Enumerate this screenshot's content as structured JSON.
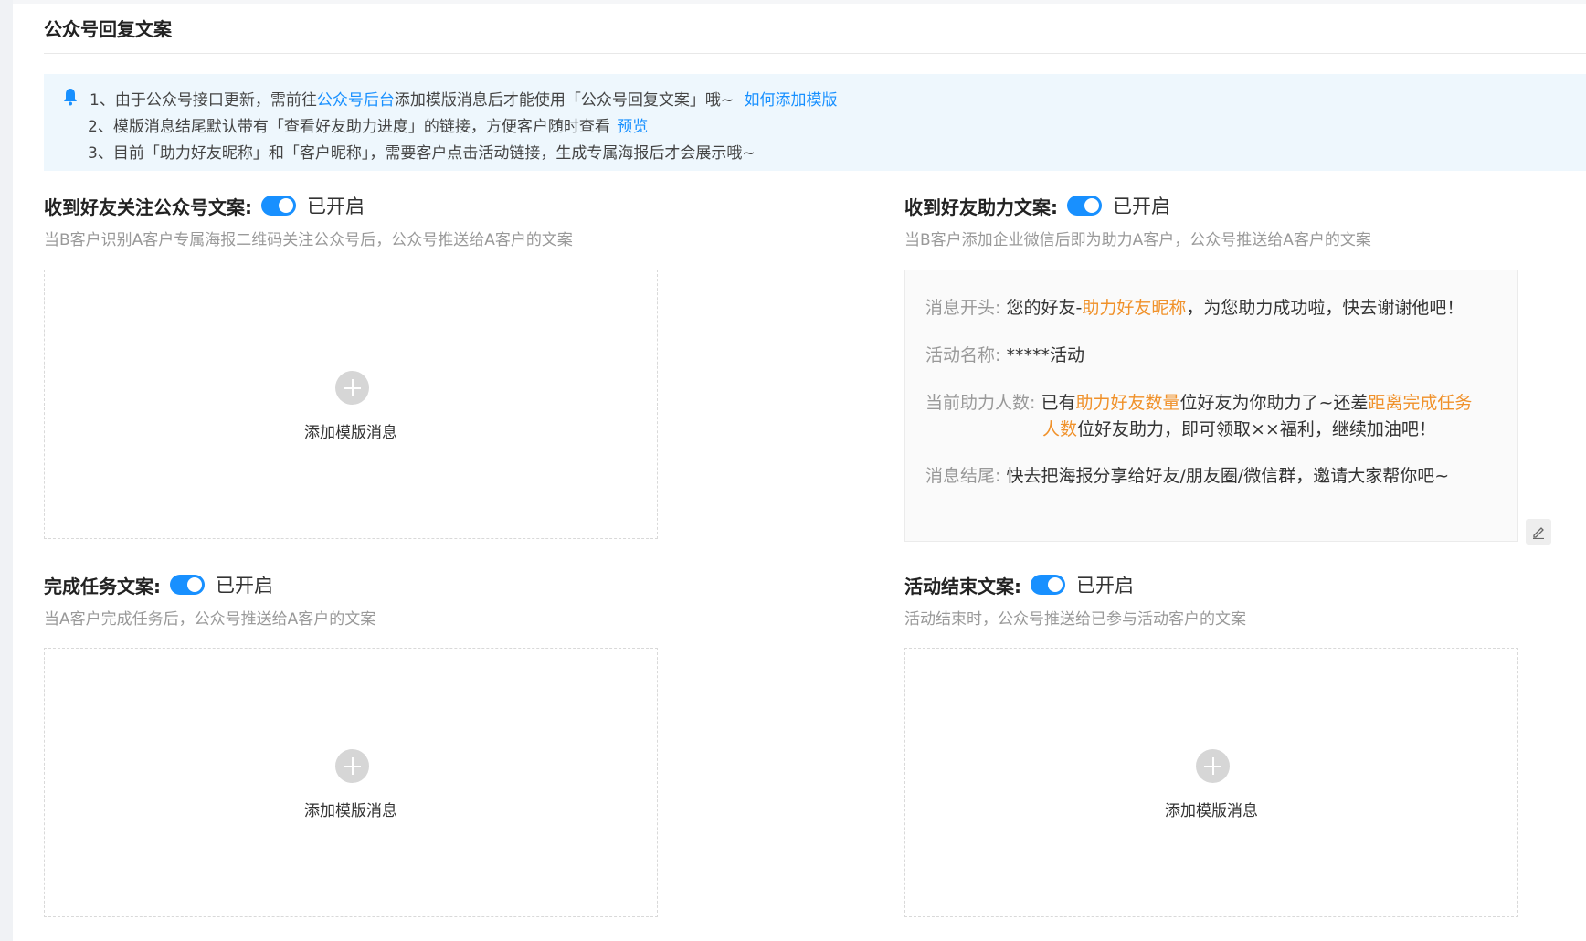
{
  "page_title": "公众号回复文案",
  "notice": {
    "line1_prefix": "1、由于公众号接口更新，需前往",
    "line1_link": "公众号后台",
    "line1_suffix": "添加模版消息后才能使用「公众号回复文案」哦~",
    "line1_help_link": "如何添加模版",
    "line2_text": "2、模版消息结尾默认带有「查看好友助力进度」的链接，方便客户随时查看",
    "line2_link": "预览",
    "line3_text": "3、目前「助力好友昵称」和「客户昵称」，需要客户点击活动链接，生成专属海报后才会展示哦~"
  },
  "colors": {
    "accent": "#1890ff",
    "highlight": "#f0912a",
    "notice_bg": "#eef7fd"
  },
  "sections": {
    "follow": {
      "title": "收到好友关注公众号文案:",
      "toggle_label": "已开启",
      "desc": "当B客户识别A客户专属海报二维码关注公众号后，公众号推送给A客户的文案",
      "add_label": "添加模版消息"
    },
    "assist": {
      "title": "收到好友助力文案:",
      "toggle_label": "已开启",
      "desc": "当B客户添加企业微信后即为助力A客户，公众号推送给A客户的文案",
      "message": {
        "opening_key": "消息开头:",
        "opening_pre": "您的好友-",
        "opening_var": "助力好友昵称",
        "opening_post": "，为您助力成功啦，快去谢谢他吧！",
        "activity_key": "活动名称:",
        "activity_value": "*****活动",
        "count_key": "当前助力人数:",
        "count_pre": "已有",
        "count_var1": "助力好友数量",
        "count_mid": "位好友为你助力了~还差",
        "count_var2_a": "距离完成任务",
        "count_var2_b": "人数",
        "count_post": "位好友助力，即可领取××福利，继续加油吧！",
        "ending_key": "消息结尾:",
        "ending_value": "快去把海报分享给好友/朋友圈/微信群，邀请大家帮你吧~"
      }
    },
    "complete": {
      "title": "完成任务文案:",
      "toggle_label": "已开启",
      "desc": "当A客户完成任务后，公众号推送给A客户的文案",
      "add_label": "添加模版消息"
    },
    "end": {
      "title": "活动结束文案:",
      "toggle_label": "已开启",
      "desc": "活动结束时，公众号推送给已参与活动客户的文案",
      "add_label": "添加模版消息"
    }
  },
  "icons": {
    "notice": "bell-icon",
    "add": "plus-circle-icon",
    "edit": "pencil-icon"
  }
}
